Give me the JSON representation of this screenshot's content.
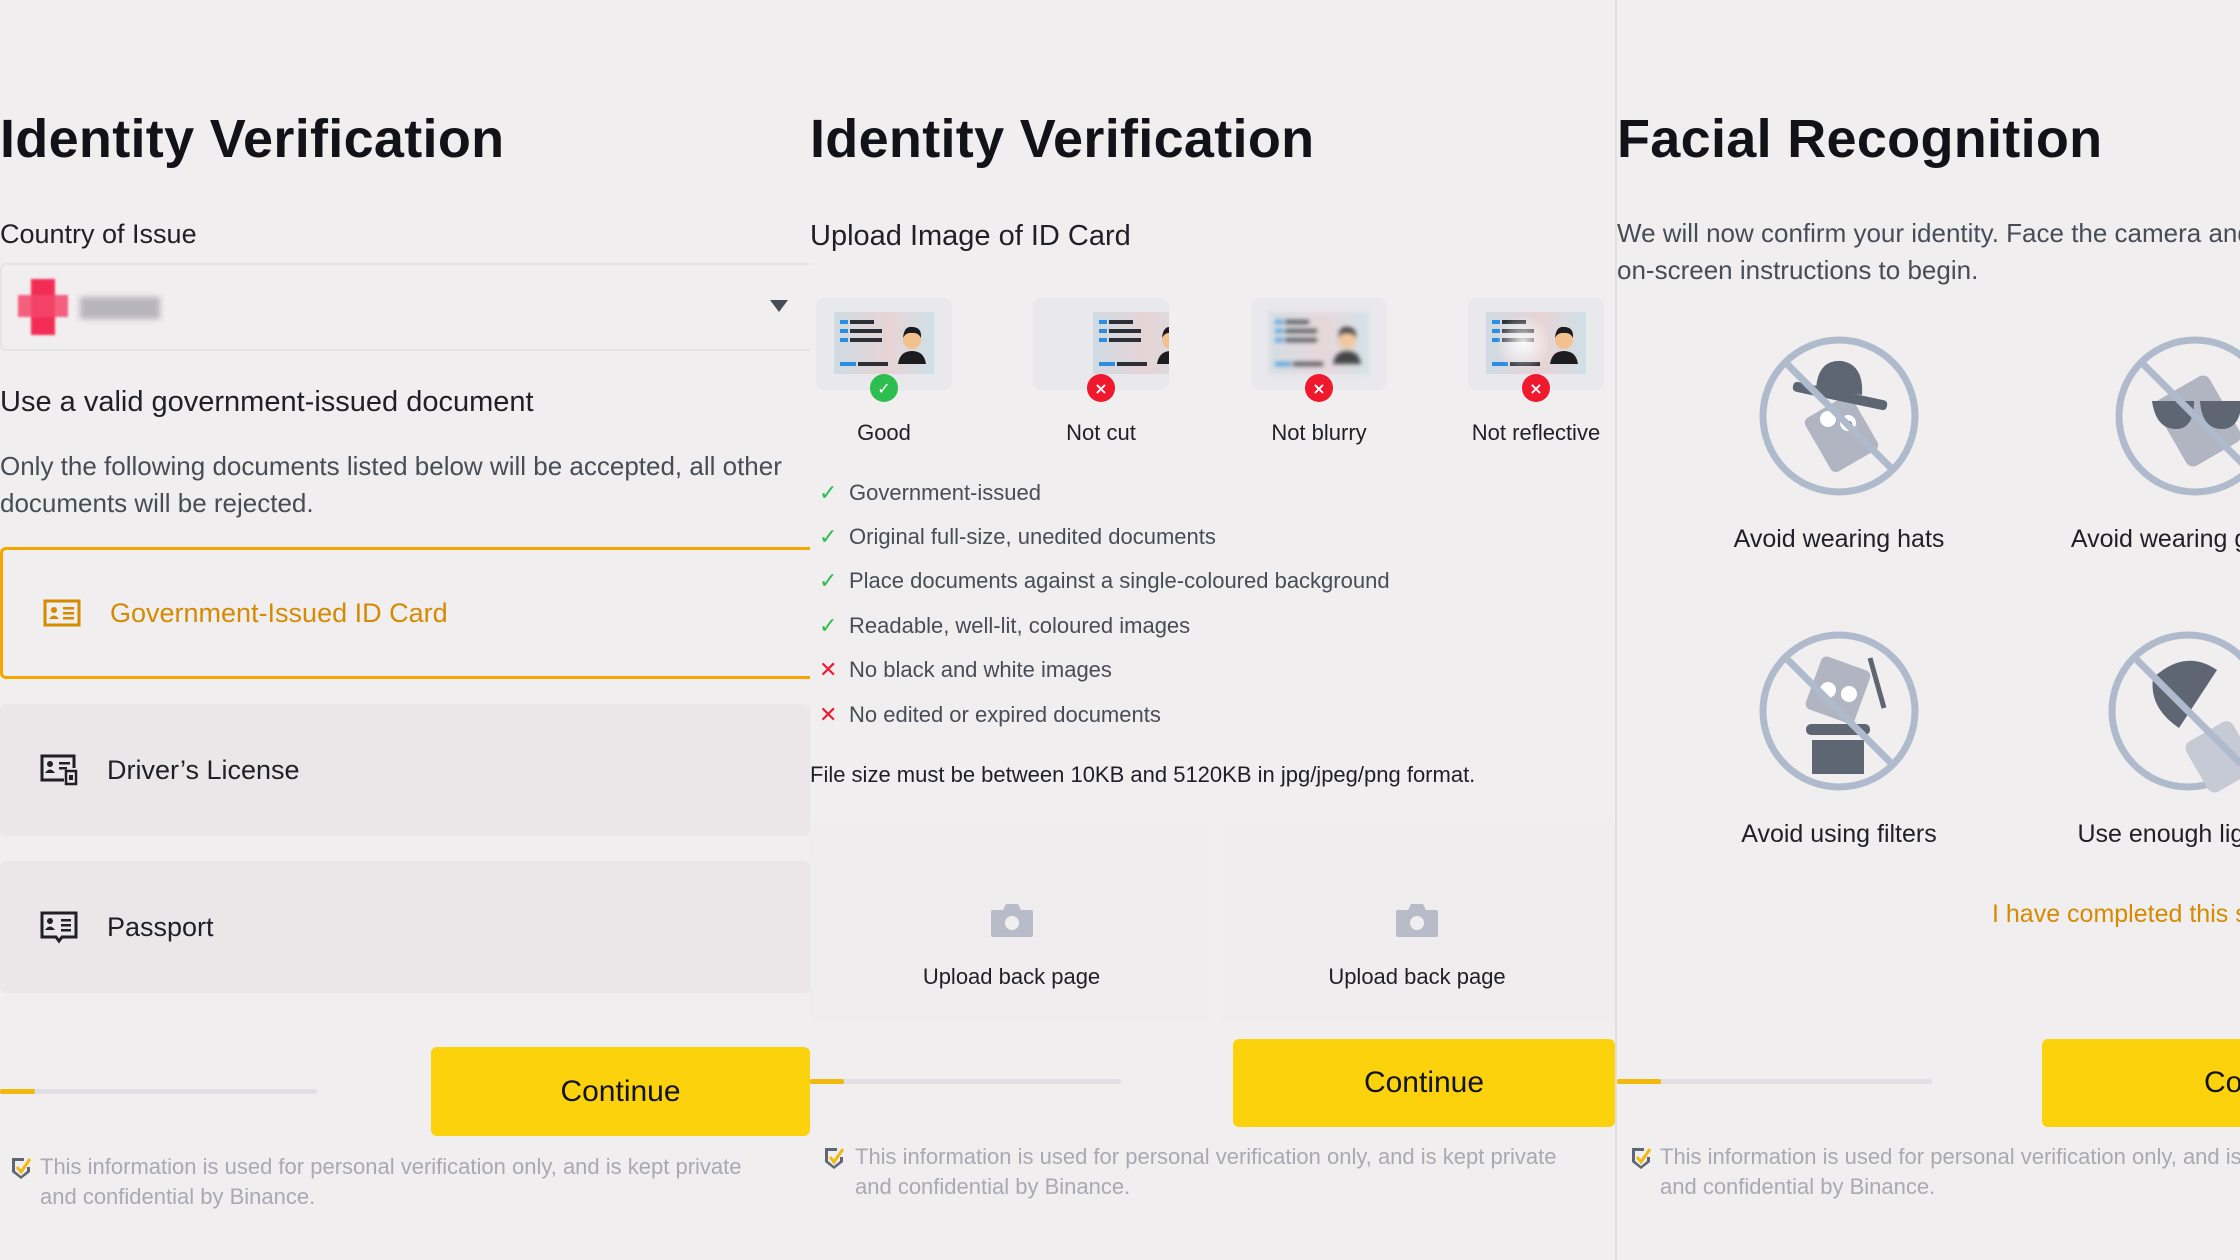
{
  "panel1": {
    "title": "Identity Verification",
    "country_label": "Country of Issue",
    "country_value": "",
    "section_heading": "Use a valid government-issued document",
    "section_desc_line1": "Only the following documents listed below will be accepted, all other",
    "section_desc_line2": "documents will be rejected.",
    "documents": [
      {
        "label": "Government-Issued ID Card",
        "icon": "id-card-icon",
        "selected": true
      },
      {
        "label": "Driver’s License",
        "icon": "drivers-license-icon",
        "selected": false
      },
      {
        "label": "Passport",
        "icon": "passport-icon",
        "selected": false
      }
    ],
    "progress": 0.11,
    "continue_label": "Continue",
    "info_line1": "This information is used for personal verification only, and is kept private",
    "info_line2": "and confidential by Binance."
  },
  "panel2": {
    "title": "Identity Verification",
    "subtitle": "Upload Image of ID Card",
    "samples": [
      {
        "label": "Good",
        "status": "ok"
      },
      {
        "label": "Not cut",
        "status": "bad"
      },
      {
        "label": "Not blurry",
        "status": "bad"
      },
      {
        "label": "Not reflective",
        "status": "bad"
      }
    ],
    "rules": [
      {
        "text": "Government-issued",
        "ok": true
      },
      {
        "text": "Original full-size, unedited documents",
        "ok": true
      },
      {
        "text": "Place documents against a single-coloured background",
        "ok": true
      },
      {
        "text": "Readable, well-lit, coloured images",
        "ok": true
      },
      {
        "text": "No black and white images",
        "ok": false
      },
      {
        "text": "No edited or expired documents",
        "ok": false
      }
    ],
    "file_note": "File size must be between 10KB and 5120KB in jpg/jpeg/png format.",
    "uploads": [
      {
        "label": "Upload back page"
      },
      {
        "label": "Upload back page"
      }
    ],
    "progress": 0.11,
    "continue_label": "Continue",
    "info_line1": "This information is used for personal verification only, and is kept private",
    "info_line2": "and confidential by Binance."
  },
  "panel3": {
    "title": "Facial Recognition",
    "desc_line1": "We will now confirm your identity. Face the camera and follow the",
    "desc_line2": "on-screen instructions to begin.",
    "tips": [
      {
        "label": "Avoid wearing hats",
        "icon": "no-hat-icon"
      },
      {
        "label": "Avoid wearing glasses",
        "icon": "no-glasses-icon"
      },
      {
        "label": "Avoid using filters",
        "icon": "no-filters-icon"
      },
      {
        "label": "Use enough lighting",
        "icon": "lighting-icon"
      }
    ],
    "completed_link": "I have completed this step",
    "progress": 0.14,
    "continue_label": "Continue",
    "info_line1": "This information is used for personal verification only, and is kept private",
    "info_line2": "and confidential by Binance."
  },
  "colors": {
    "accent_yellow": "#fcd20c",
    "accent_orange": "#d58a00",
    "ok_green": "#2ebd4f",
    "bad_red": "#f0182d",
    "background": "#f1eeef"
  }
}
